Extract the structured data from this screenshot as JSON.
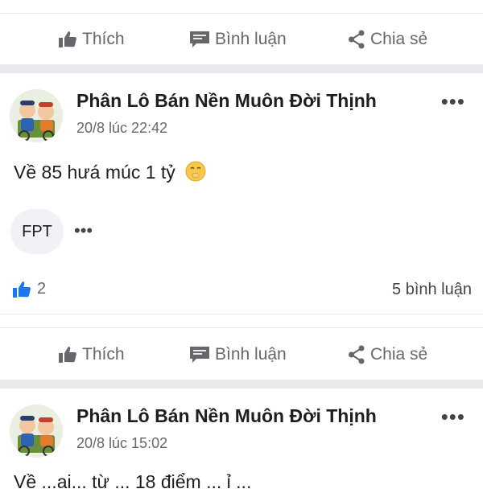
{
  "actions": {
    "like": "Thích",
    "comment": "Bình luận",
    "share": "Chia sẻ"
  },
  "posts": [
    {
      "author": "Phân Lô Bán Nền Muôn Đời Thịnh",
      "time": "20/8 lúc 22:42",
      "text": "Về 85 hưá múc 1 tỷ",
      "emoji": "shushing-face",
      "tag": "FPT",
      "likes": "2",
      "comments": "5 bình luận"
    },
    {
      "author": "Phân Lô Bán Nền Muôn Đời Thịnh",
      "time": "20/8 lúc 15:02",
      "text": "Về ...ai... từ ... 18 điểm ... ỉ ..."
    }
  ],
  "colors": {
    "text": "#1c1e21",
    "muted": "#65676b",
    "like_blue": "#1877f2",
    "separator": "#e9eaee"
  }
}
